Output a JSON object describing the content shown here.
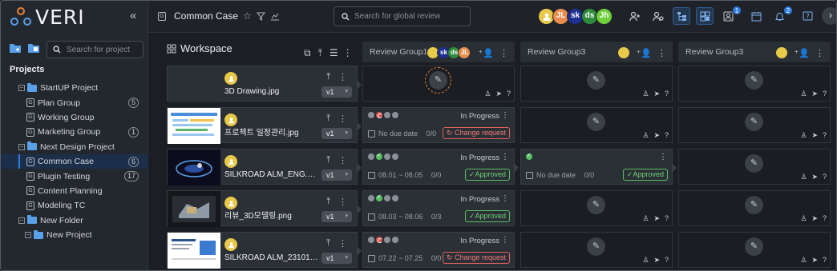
{
  "app": {
    "logo_text": "VERI"
  },
  "sidebar": {
    "search_placeholder": "Search for project",
    "projects_title": "Projects",
    "tree": [
      {
        "label": "StartUP Project",
        "type": "project",
        "indent": 0,
        "expanded": true
      },
      {
        "label": "Plan Group",
        "type": "group",
        "indent": 1,
        "count": "5"
      },
      {
        "label": "Working Group",
        "type": "group",
        "indent": 1
      },
      {
        "label": "Marketing Group",
        "type": "group",
        "indent": 1,
        "count": "1"
      },
      {
        "label": "Next Design Project",
        "type": "project",
        "indent": 0,
        "expanded": true
      },
      {
        "label": "Common Case",
        "type": "group",
        "indent": 1,
        "count": "6",
        "selected": true
      },
      {
        "label": "Plugin Testing",
        "type": "group",
        "indent": 1,
        "count": "17"
      },
      {
        "label": "Content Planning",
        "type": "group",
        "indent": 1
      },
      {
        "label": "Modeling TC",
        "type": "group",
        "indent": 1
      },
      {
        "label": "New Folder",
        "type": "folder",
        "indent": 0,
        "expanded": true
      },
      {
        "label": "New Project",
        "type": "project",
        "indent": 1
      }
    ]
  },
  "topbar": {
    "title": "Common Case",
    "search_placeholder": "Search for global review",
    "avatars": [
      {
        "initials": "",
        "color": "#e7c94a",
        "type": "user-icon"
      },
      {
        "initials": "JL",
        "color": "#e98d4f"
      },
      {
        "initials": "sk",
        "color": "#1d2f8f"
      },
      {
        "initials": "ds",
        "color": "#2e8b3e"
      },
      {
        "initials": "Jh",
        "color": "#6fcf3b"
      }
    ],
    "badges": {
      "notifications_a": "1",
      "notifications_b": "2"
    }
  },
  "workspace": {
    "title": "Workspace",
    "columns": [
      {
        "title": "Review Group1",
        "avatars": [
          "sk",
          "ds",
          "JL"
        ]
      },
      {
        "title": "Review Group3"
      },
      {
        "title": "Review Group3"
      }
    ],
    "files": [
      {
        "name": "3D Drawing.jpg",
        "version": "v1",
        "thumb": "none"
      },
      {
        "name": "프로젝트 일정관리.jpg",
        "version": "v1",
        "thumb": "doc"
      },
      {
        "name": "SILKROAD ALM_ENG.mp4",
        "version": "v1",
        "thumb": "dark"
      },
      {
        "name": "리뷰_3D모델링.png",
        "version": "v1",
        "thumb": "model"
      },
      {
        "name": "SILKROAD ALM_231015_W...",
        "version": "v1",
        "thumb": "slide"
      }
    ],
    "reviews": {
      "row2": {
        "status": "In Progress",
        "due": "No due date",
        "count": "0/0",
        "tag": "Change request"
      },
      "row3a": {
        "status": "In Progress",
        "due": "08.01 ~ 08.05",
        "count": "0/0",
        "tag": "Approved"
      },
      "row3b": {
        "due": "No due date",
        "count": "0/0",
        "tag": "Approved"
      },
      "row4": {
        "status": "In Progress",
        "due": "08.03 ~ 08.06",
        "count": "0/3",
        "tag": "Approved"
      },
      "row5": {
        "status": "In Progress",
        "due": "07.22 ~ 07.25",
        "count": "0/0",
        "tag": "Change request"
      }
    }
  },
  "colors": {
    "accent": "#2f7de1",
    "approved": "#58c061",
    "change": "#e0605c",
    "highlight": "#e8833a"
  }
}
